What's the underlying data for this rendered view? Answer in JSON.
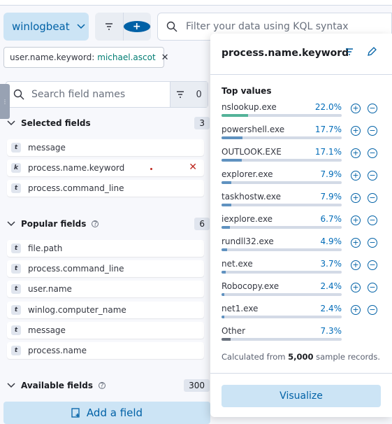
{
  "header": {
    "dataview": "winlogbeat",
    "kql_placeholder": "Filter your data using KQL syntax"
  },
  "filter_pill": {
    "field": "user.name.keyword:",
    "value": "michael.ascot"
  },
  "sidebar": {
    "search_placeholder": "Search field names",
    "filter_count": "0",
    "selected": {
      "title": "Selected fields",
      "count": "3",
      "fields": [
        {
          "type": "t",
          "name": "message"
        },
        {
          "type": "k",
          "name": "process.name.keyword"
        },
        {
          "type": "t",
          "name": "process.command_line"
        }
      ]
    },
    "popular": {
      "title": "Popular fields",
      "count": "6",
      "fields": [
        {
          "type": "t",
          "name": "file.path"
        },
        {
          "type": "t",
          "name": "process.command_line"
        },
        {
          "type": "t",
          "name": "user.name"
        },
        {
          "type": "t",
          "name": "winlog.computer_name"
        },
        {
          "type": "t",
          "name": "message"
        },
        {
          "type": "t",
          "name": "process.name"
        }
      ]
    },
    "available": {
      "title": "Available fields",
      "count": "300"
    },
    "add_field": "Add a field"
  },
  "popover": {
    "title": "process.name.keyword",
    "top_values_title": "Top values",
    "values": [
      {
        "name": "nslookup.exe",
        "pct": "22.0%",
        "fraction": 0.22
      },
      {
        "name": "powershell.exe",
        "pct": "17.7%",
        "fraction": 0.177
      },
      {
        "name": "OUTLOOK.EXE",
        "pct": "17.1%",
        "fraction": 0.171
      },
      {
        "name": "explorer.exe",
        "pct": "7.9%",
        "fraction": 0.079
      },
      {
        "name": "taskhostw.exe",
        "pct": "7.9%",
        "fraction": 0.079
      },
      {
        "name": "iexplore.exe",
        "pct": "6.7%",
        "fraction": 0.067
      },
      {
        "name": "rundll32.exe",
        "pct": "4.9%",
        "fraction": 0.049
      },
      {
        "name": "net.exe",
        "pct": "3.7%",
        "fraction": 0.037
      },
      {
        "name": "Robocopy.exe",
        "pct": "2.4%",
        "fraction": 0.024
      },
      {
        "name": "net1.exe",
        "pct": "2.4%",
        "fraction": 0.024
      }
    ],
    "other": {
      "name": "Other",
      "pct": "7.3%",
      "fraction": 0.073
    },
    "calc_prefix": "Calculated from",
    "calc_count": "5,000",
    "calc_suffix": "sample records.",
    "visualize": "Visualize"
  }
}
